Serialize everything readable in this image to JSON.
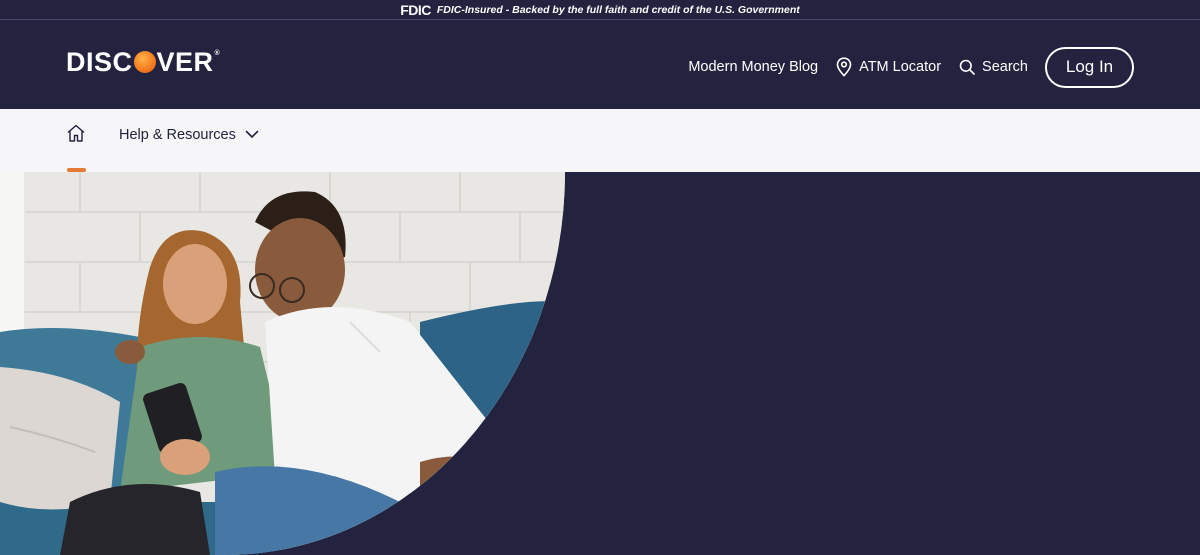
{
  "fdic": {
    "logo": "FDIC",
    "text": "FDIC-Insured - Backed by the full faith and credit of the U.S. Government"
  },
  "brand": {
    "name_pre": "DISC",
    "name_post": "VER",
    "orange": "#f47920",
    "navy": "#23223f"
  },
  "nav": {
    "blog": "Modern Money Blog",
    "atm": "ATM Locator",
    "search": "Search",
    "login": "Log In"
  },
  "subnav": {
    "home_icon": "home-icon",
    "help": "Help & Resources"
  },
  "hero": {
    "image": "couple-on-couch-looking-at-phone"
  }
}
